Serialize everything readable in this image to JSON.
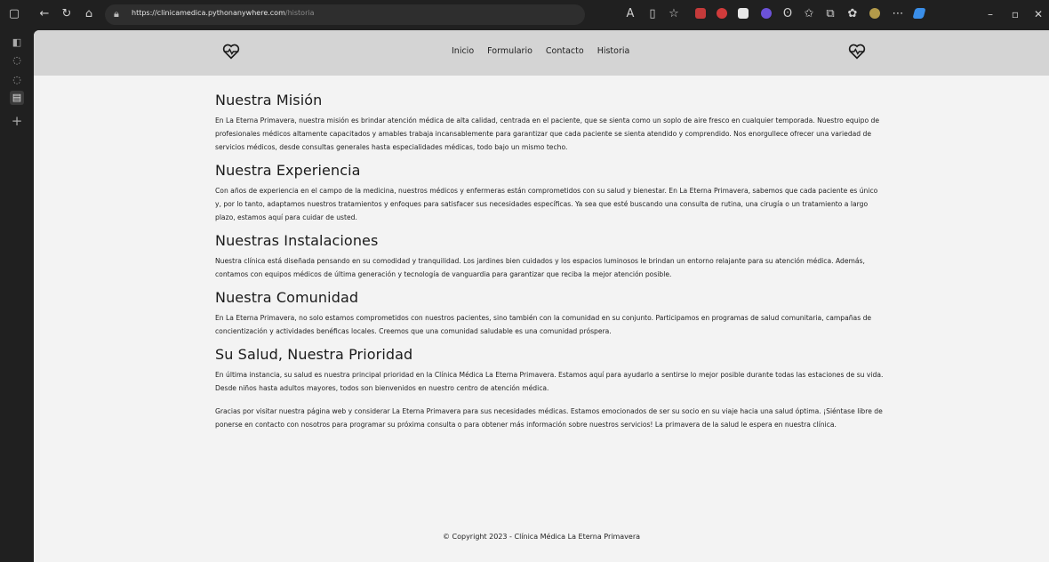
{
  "browser": {
    "url_host": "https://clinicamedica.pythonanywhere.com",
    "url_path": "/historia"
  },
  "site": {
    "nav": [
      "Inicio",
      "Formulario",
      "Contacto",
      "Historia"
    ]
  },
  "sections": [
    {
      "title": "Nuestra Misión",
      "paragraphs": [
        "En La Eterna Primavera, nuestra misión es brindar atención médica de alta calidad, centrada en el paciente, que se sienta como un soplo de aire fresco en cualquier temporada. Nuestro equipo de profesionales médicos altamente capacitados y amables trabaja incansablemente para garantizar que cada paciente se sienta atendido y comprendido. Nos enorgullece ofrecer una variedad de servicios médicos, desde consultas generales hasta especialidades médicas, todo bajo un mismo techo."
      ]
    },
    {
      "title": "Nuestra Experiencia",
      "paragraphs": [
        "Con años de experiencia en el campo de la medicina, nuestros médicos y enfermeras están comprometidos con su salud y bienestar. En La Eterna Primavera, sabemos que cada paciente es único y, por lo tanto, adaptamos nuestros tratamientos y enfoques para satisfacer sus necesidades específicas. Ya sea que esté buscando una consulta de rutina, una cirugía o un tratamiento a largo plazo, estamos aquí para cuidar de usted."
      ]
    },
    {
      "title": "Nuestras Instalaciones",
      "paragraphs": [
        "Nuestra clínica está diseñada pensando en su comodidad y tranquilidad. Los jardines bien cuidados y los espacios luminosos le brindan un entorno relajante para su atención médica. Además, contamos con equipos médicos de última generación y tecnología de vanguardia para garantizar que reciba la mejor atención posible."
      ]
    },
    {
      "title": "Nuestra Comunidad",
      "paragraphs": [
        "En La Eterna Primavera, no solo estamos comprometidos con nuestros pacientes, sino también con la comunidad en su conjunto. Participamos en programas de salud comunitaria, campañas de concientización y actividades benéficas locales. Creemos que una comunidad saludable es una comunidad próspera."
      ]
    },
    {
      "title": "Su Salud, Nuestra Prioridad",
      "paragraphs": [
        "En última instancia, su salud es nuestra principal prioridad en la Clínica Médica La Eterna Primavera. Estamos aquí para ayudarlo a sentirse lo mejor posible durante todas las estaciones de su vida. Desde niños hasta adultos mayores, todos son bienvenidos en nuestro centro de atención médica.",
        "Gracias por visitar nuestra página web y considerar La Eterna Primavera para sus necesidades médicas. Estamos emocionados de ser su socio en su viaje hacia una salud óptima. ¡Siéntase libre de ponerse en contacto con nosotros para programar su próxima consulta o para obtener más información sobre nuestros servicios! La primavera de la salud le espera en nuestra clínica."
      ]
    }
  ],
  "footer": "© Copyright 2023 - Clínica Médica La Eterna Primavera",
  "icons": {
    "logo": "heartbeat-heart-icon",
    "back": "back-arrow-icon",
    "refresh": "refresh-icon",
    "home": "home-icon",
    "lock": "lock-icon"
  },
  "colors": {
    "header_bg": "#d4d4d4",
    "page_bg": "#f3f3f3",
    "chrome_bg": "#202020"
  }
}
